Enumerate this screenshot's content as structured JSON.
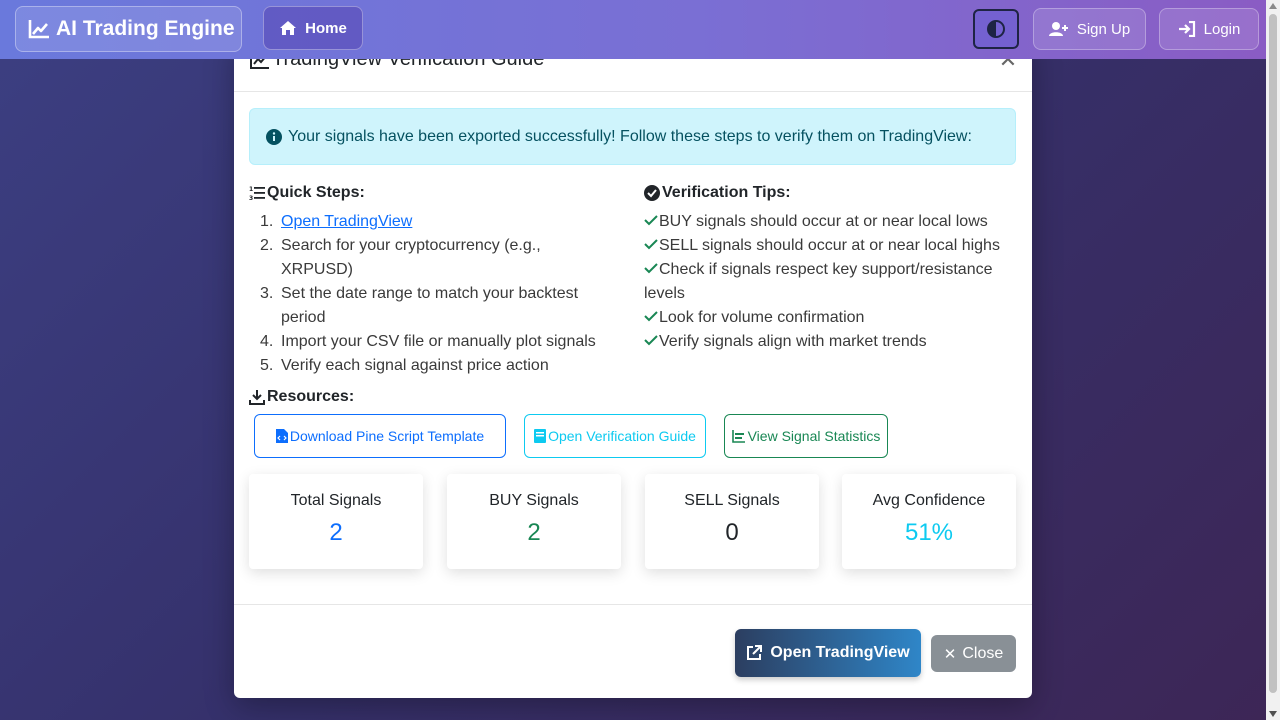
{
  "navbar": {
    "brand": "AI Trading Engine",
    "home": "Home",
    "signup": "Sign Up",
    "login": "Login"
  },
  "modal": {
    "title": "TradingView Verification Guide",
    "alert": "Your signals have been exported successfully! Follow these steps to verify them on TradingView:",
    "quick_steps_title": "Quick Steps:",
    "steps": [
      {
        "num": "1.",
        "text": "Open TradingView"
      },
      {
        "num": "2.",
        "text": "Search for your cryptocurrency (e.g., XRPUSD)"
      },
      {
        "num": "3.",
        "text": "Set the date range to match your backtest period"
      },
      {
        "num": "4.",
        "text": "Import your CSV file or manually plot signals"
      },
      {
        "num": "5.",
        "text": "Verify each signal against price action"
      }
    ],
    "tips_title": "Verification Tips:",
    "tips": [
      "BUY signals should occur at or near local lows",
      "SELL signals should occur at or near local highs",
      "Check if signals respect key support/resistance levels",
      "Look for volume confirmation",
      "Verify signals align with market trends"
    ],
    "resources_title": "Resources:",
    "resources": {
      "pine": "Download Pine Script Template",
      "guide": "Open Verification Guide",
      "stats": "View Signal Statistics"
    },
    "stats": [
      {
        "label": "Total Signals",
        "value": "2"
      },
      {
        "label": "BUY Signals",
        "value": "2"
      },
      {
        "label": "SELL Signals",
        "value": "0"
      },
      {
        "label": "Avg Confidence",
        "value": "51%"
      }
    ],
    "footer": {
      "open_tv": "Open TradingView",
      "close": "Close"
    }
  },
  "colors": {
    "primary": "#0d6efd",
    "info": "#0dcaf0",
    "success": "#198754",
    "dark": "#212529"
  }
}
